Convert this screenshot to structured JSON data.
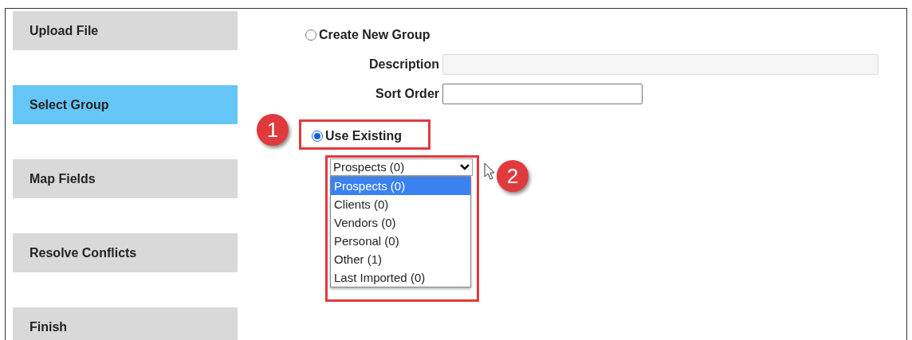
{
  "steps": [
    {
      "label": "Upload File",
      "selected": false
    },
    {
      "label": "Select Group",
      "selected": true
    },
    {
      "label": "Map Fields",
      "selected": false
    },
    {
      "label": "Resolve Conflicts",
      "selected": false
    },
    {
      "label": "Finish",
      "selected": false
    }
  ],
  "create_new": {
    "label": "Create New Group",
    "selected": false,
    "fields": [
      {
        "label": "Description",
        "disabled": true,
        "kind": "wide"
      },
      {
        "label": "Sort Order",
        "disabled": false,
        "kind": "short"
      }
    ]
  },
  "use_existing": {
    "label": "Use Existing",
    "selected": true,
    "annotation": "1"
  },
  "group_select": {
    "value": "Prospects (0)",
    "annotation": "2",
    "options": [
      {
        "label": "Prospects (0)",
        "selected": true
      },
      {
        "label": "Clients (0)",
        "selected": false
      },
      {
        "label": "Vendors (0)",
        "selected": false
      },
      {
        "label": "Personal (0)",
        "selected": false
      },
      {
        "label": "Other (1)",
        "selected": false
      },
      {
        "label": "Last Imported (0)",
        "selected": false
      }
    ]
  }
}
